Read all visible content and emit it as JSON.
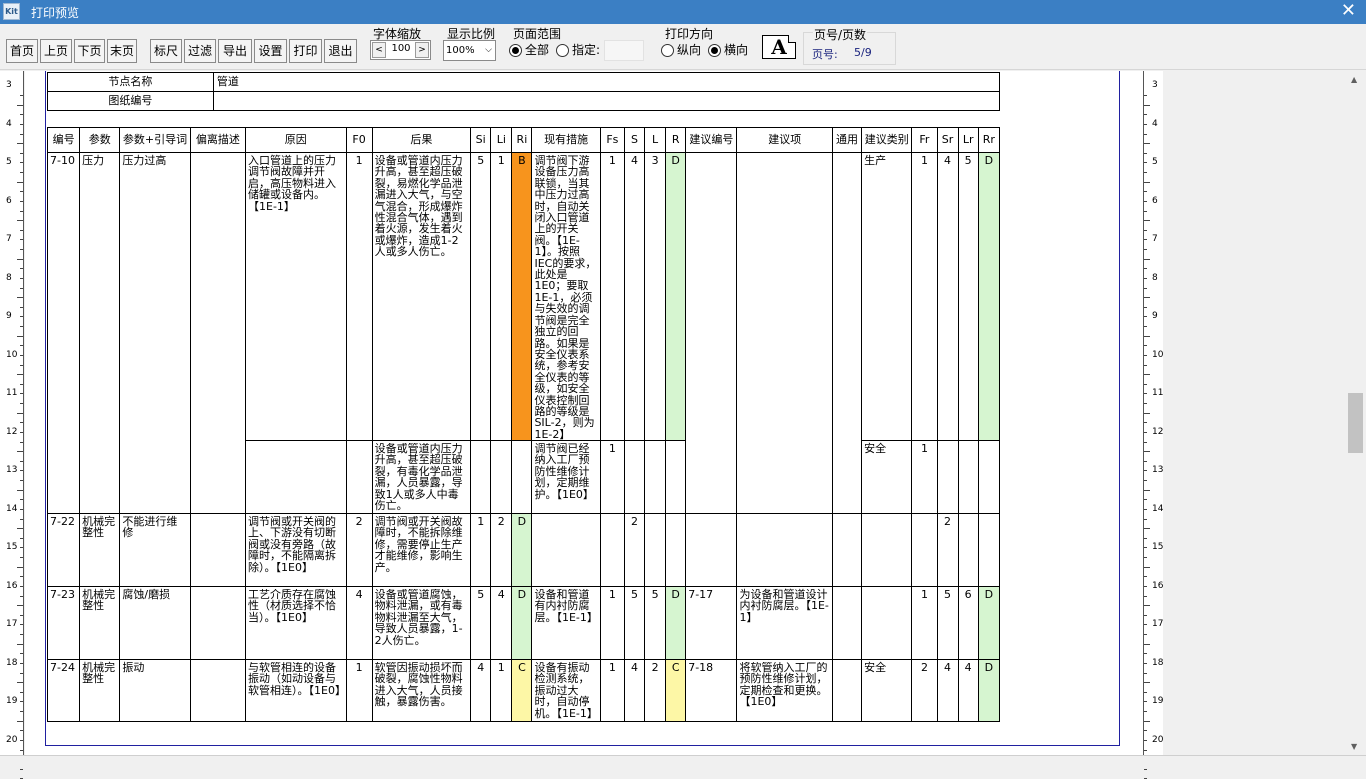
{
  "window": {
    "icon_label": "Kit",
    "title": "打印预览",
    "close": "✕"
  },
  "toolbar": {
    "buttons": [
      "首页",
      "上页",
      "下页",
      "末页",
      "标尺",
      "过滤",
      "导出",
      "设置",
      "打印",
      "退出"
    ],
    "font_scale": {
      "label": "字体缩放",
      "dec": "<",
      "inc": ">",
      "value": "100"
    },
    "display_ratio": {
      "label": "显示比例",
      "value": "100%",
      "caret": "⌵"
    },
    "page_range": {
      "label": "页面范围",
      "all": "全部",
      "specify": "指定:",
      "selected": "all"
    },
    "orientation": {
      "label": "打印方向",
      "portrait": "纵向",
      "landscape": "横向",
      "selected": "landscape"
    },
    "font_icon": "A",
    "page_info": {
      "label": "页号/页数",
      "page_label": "页号:",
      "page_value": "5/9"
    }
  },
  "ruler": {
    "left_numbers": [
      "3",
      "4",
      "5",
      "6",
      "7",
      "8",
      "9",
      "10",
      "11",
      "12",
      "13",
      "14",
      "15",
      "16",
      "17",
      "18",
      "19",
      "20"
    ],
    "right_numbers": [
      "3",
      "4",
      "5",
      "6",
      "7",
      "8",
      "9",
      "10",
      "11",
      "12",
      "13",
      "14",
      "15",
      "16",
      "17",
      "18",
      "19",
      "20"
    ]
  },
  "info": {
    "node_name_label": "节点名称",
    "node_name_value": "管道",
    "drawing_no_label": "图纸编号",
    "drawing_no_value": ""
  },
  "headers": [
    "编号",
    "参数",
    "参数+引导词",
    "偏离描述",
    "原因",
    "F0",
    "后果",
    "Si",
    "Li",
    "Ri",
    "现有措施",
    "Fs",
    "S",
    "L",
    "R",
    "建议编号",
    "建议项",
    "通用",
    "建议类别",
    "Fr",
    "Sr",
    "Lr",
    "Rr"
  ],
  "rows": {
    "r1": {
      "no": "7-10",
      "param": "压力",
      "guide": "压力过高",
      "dev": "",
      "cause": "入口管道上的压力调节阀故障并开启，高压物料进入储罐或设备内。【1E-1】",
      "f0": "1",
      "cons": "设备或管道内压力升高，甚至超压破裂，易燃化学品泄漏进入大气，与空气混合，形成爆炸性混合气体，遇到着火源，发生着火或爆炸，造成1-2人或多人伤亡。",
      "si": "5",
      "li": "1",
      "ri": "B",
      "measure": "调节阀下游设备压力高联锁，当其中压力过高时，自动关闭入口管道上的开关阀。【1E-1】。按照IEC的要求，此处是1E0；要取1E-1，必须与失效的调节阀是完全独立的回路。如果是安全仪表系统，参考安全仪表的等级，如安全仪表控制回路的等级是SIL-2，则为1E-2】",
      "fs": "1",
      "s": "4",
      "l": "3",
      "r": "D",
      "sugNo": "",
      "sug": "",
      "common": "",
      "cat": "生产",
      "fr": "1",
      "sr": "4",
      "lr": "5",
      "rr": "D"
    },
    "r2": {
      "cons": "设备或管道内压力升高，甚至超压破裂，有毒化学品泄漏，人员暴露，导致1人或多人中毒伤亡。",
      "measure": "调节阀已经纳入工厂预防性维修计划，定期维护。【1E0】",
      "fs": "1",
      "cat": "安全",
      "fr": "1"
    },
    "r3": {
      "no": "7-22",
      "param": "机械完整性",
      "guide": "不能进行维修",
      "dev": "",
      "cause": "调节阀或开关阀的上、下游没有切断阀或没有旁路（故障时，不能隔离拆除）。【1E0】",
      "f0": "2",
      "cons": "调节阀或开关阀故障时，不能拆除维修，需要停止生产才能维修，影响生产。",
      "si": "1",
      "li": "2",
      "ri": "D",
      "measure": "",
      "fs": "",
      "s": "2",
      "l": "",
      "r": "",
      "sugNo": "",
      "sug": "",
      "common": "",
      "cat": "",
      "fr": "",
      "sr": "2",
      "lr": "",
      "rr": ""
    },
    "r4": {
      "no": "7-23",
      "param": "机械完整性",
      "guide": "腐蚀/磨损",
      "dev": "",
      "cause": "工艺介质存在腐蚀性（材质选择不恰当）。【1E0】",
      "f0": "4",
      "cons": "设备或管道腐蚀，物料泄漏，或有毒物料泄漏至大气，导致人员暴露，1-2人伤亡。",
      "si": "5",
      "li": "4",
      "ri": "D",
      "measure": "设备和管道有内衬防腐层。【1E-1】",
      "fs": "1",
      "s": "5",
      "l": "5",
      "r": "D",
      "sugNo": "7-17",
      "sug": "为设备和管道设计内衬防腐层。【1E-1】",
      "common": "",
      "cat": "",
      "fr": "1",
      "sr": "5",
      "lr": "6",
      "rr": "D"
    },
    "r5": {
      "no": "7-24",
      "param": "机械完整性",
      "guide": "振动",
      "dev": "",
      "cause": "与软管相连的设备振动（如动设备与软管相连）。【1E0】",
      "f0": "1",
      "cons": "软管因振动损坏而破裂，腐蚀性物料进入大气，人员接触，暴露伤害。",
      "si": "4",
      "li": "1",
      "ri": "C",
      "measure": "设备有振动检测系统，振动过大时，自动停机。【1E-1】",
      "fs": "1",
      "s": "4",
      "l": "2",
      "r": "C",
      "sugNo": "7-18",
      "sug": "将软管纳入工厂的预防性维修计划，定期检查和更换。【1E0】",
      "common": "",
      "cat": "安全",
      "fr": "2",
      "sr": "4",
      "lr": "4",
      "rr": "D"
    }
  }
}
